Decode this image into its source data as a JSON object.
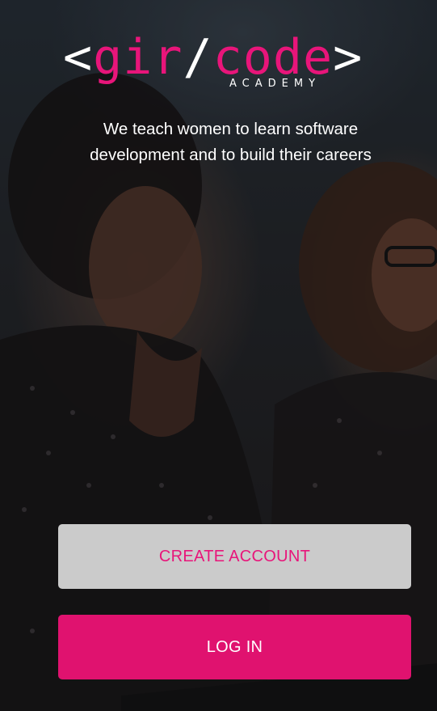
{
  "app": {
    "logo": {
      "open_bracket": "<",
      "word_left": "gir",
      "slash": "/",
      "word_right": "code",
      "close_bracket": ">",
      "subtitle": "ACADEMY"
    },
    "tagline": "We teach women to learn software development and to build their careers"
  },
  "actions": {
    "create_account_label": "CREATE ACCOUNT",
    "login_label": "LOG IN"
  },
  "colors": {
    "brand_pink": "#e0126f",
    "secondary_button": "#cbcbcb",
    "text_light": "#ffffff"
  }
}
